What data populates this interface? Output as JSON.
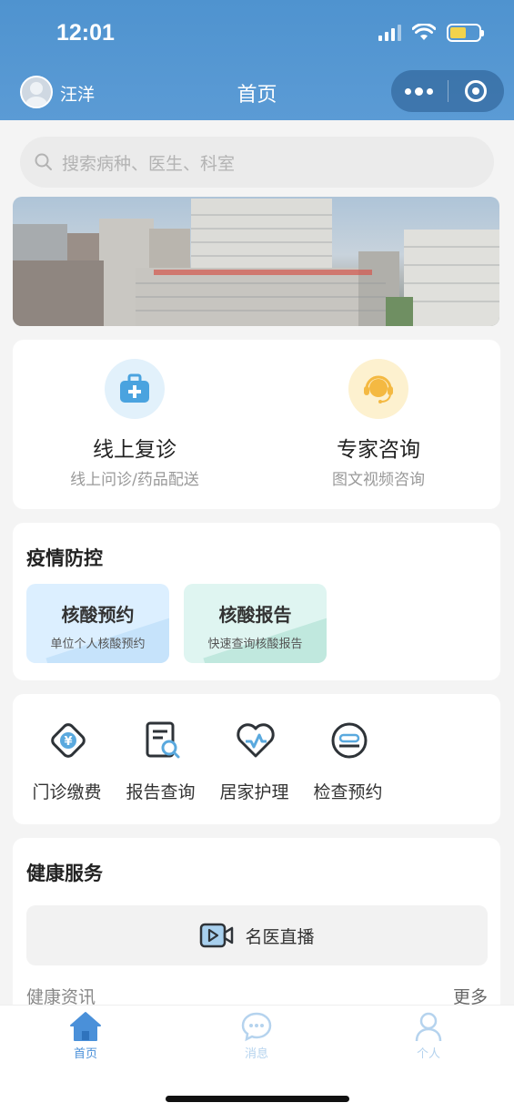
{
  "status_bar": {
    "time": "12:01"
  },
  "header": {
    "username": "汪洋",
    "title": "首页"
  },
  "search": {
    "placeholder": "搜索病种、医生、科室"
  },
  "quick_actions": [
    {
      "title": "线上复诊",
      "subtitle": "线上问诊/药品配送",
      "icon": "medical-kit-icon",
      "color": "#e2f1fb"
    },
    {
      "title": "专家咨询",
      "subtitle": "图文视频咨询",
      "icon": "headset-icon",
      "color": "#fdf1cf"
    }
  ],
  "epidemic": {
    "title": "疫情防控",
    "tiles": [
      {
        "title": "核酸预约",
        "subtitle": "单位个人核酸预约",
        "color": "#dcefff"
      },
      {
        "title": "核酸报告",
        "subtitle": "快速查询核酸报告",
        "color": "#dff5f1"
      }
    ]
  },
  "services": [
    {
      "label": "门诊缴费",
      "icon": "yuan-payment-icon"
    },
    {
      "label": "报告查询",
      "icon": "report-search-icon"
    },
    {
      "label": "居家护理",
      "icon": "heart-care-icon"
    },
    {
      "label": "检查预约",
      "icon": "exam-booking-icon"
    }
  ],
  "health": {
    "title": "健康服务",
    "live_label": "名医直播",
    "news_label": "健康资讯",
    "more_label": "更多"
  },
  "tabbar": [
    {
      "label": "首页",
      "active": true
    },
    {
      "label": "消息",
      "active": false
    },
    {
      "label": "个人",
      "active": false
    }
  ],
  "colors": {
    "header": "#5b9bd5",
    "accent": "#4a90d9",
    "tab_inactive": "#b5d3ee"
  }
}
